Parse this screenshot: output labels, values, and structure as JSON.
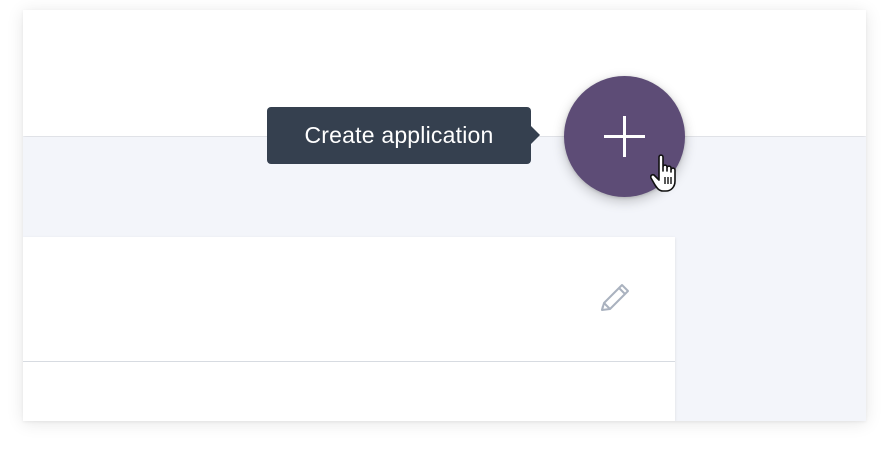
{
  "tooltip": {
    "text": "Create application"
  },
  "fab": {
    "label": "Create application",
    "icon": "plus-icon",
    "color": "#5d4c76"
  },
  "card": {
    "edit_icon": "pencil-icon"
  },
  "colors": {
    "tooltip_bg": "#35404f",
    "page_bg": "#f3f5fa",
    "surface": "#ffffff",
    "divider": "#d7dbe1",
    "icon_muted": "#aab2bf"
  }
}
